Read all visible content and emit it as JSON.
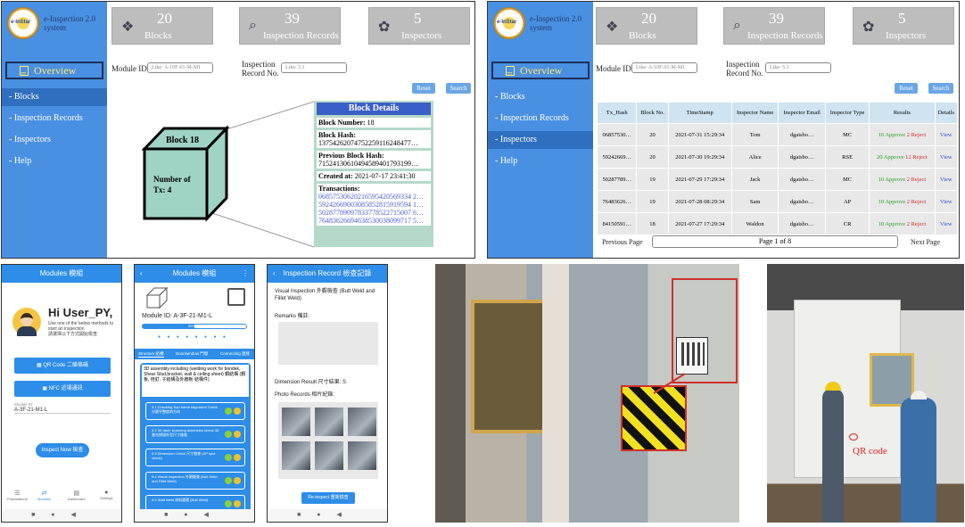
{
  "app": {
    "title_line1": "e-Inspection 2.0",
    "title_line2": "system",
    "logo_text": "e-InStar"
  },
  "sidebar": {
    "overview": "Overview",
    "items": [
      "- Blocks",
      "- Inspection Records",
      "- Inspectors",
      "- Help"
    ]
  },
  "stats": [
    {
      "value": "20",
      "label": "Blocks",
      "icon": "blocks-icon"
    },
    {
      "value": "39",
      "label": "Inspection Records",
      "icon": "clipboard-search-icon"
    },
    {
      "value": "5",
      "label": "Inspectors",
      "icon": "inspector-gear-icon"
    }
  ],
  "filters": {
    "module_label": "Module ID",
    "module_placeholder": "Like: A-10F-01-M-M1",
    "record_label_1": "Inspection",
    "record_label_2": "Record No.",
    "record_placeholder": "Like: 5.1",
    "reset": "Reset",
    "search": "Search"
  },
  "block_diagram": {
    "title": "Block 18",
    "body_1": "Number of",
    "body_2": "Tx: 4"
  },
  "block_details": {
    "header": "Block Details",
    "number_label": "Block Number:",
    "number": "18",
    "hash_label": "Block Hash:",
    "hash": "13754262074752259116248477…",
    "prev_label": "Previous Block Hash:",
    "prev": "71524130610494589401793199…",
    "created_label": "Created at:",
    "created": "2021-07-17 23:41:30",
    "tx_label": "Transactions:",
    "tx": [
      "06857530620216595420569334 2…",
      "59242669003085852815919594 1…",
      "50287789097833778522715007 6…",
      "76483626694638530038099717 5…"
    ]
  },
  "records": {
    "headers": [
      "Tx_Hash",
      "Block No.",
      "TimeStamp",
      "Inspector Name",
      "Inspector Email",
      "Inspector Type",
      "Results",
      "Details"
    ],
    "rows": [
      {
        "hash": "06857530…",
        "block": "20",
        "time": "2021-07-31 15:29:34",
        "name": "Tom",
        "email": "dgaisbo…",
        "type": "MC",
        "approve": "10 Approve",
        "reject": "2 Reject",
        "view": "View"
      },
      {
        "hash": "59242669…",
        "block": "20",
        "time": "2021-07-30 19:29:34",
        "name": "Alice",
        "email": "dgaisbo…",
        "type": "RSE",
        "approve": "20 Approve",
        "reject": "12 Reject",
        "view": "View"
      },
      {
        "hash": "50287789…",
        "block": "19",
        "time": "2021-07-29 17:29:34",
        "name": "Jack",
        "email": "dgaisbo…",
        "type": "MC",
        "approve": "10 Approve",
        "reject": "2 Reject",
        "view": "View"
      },
      {
        "hash": "76483626…",
        "block": "19",
        "time": "2021-07-28 08:29:34",
        "name": "Sam",
        "email": "dgaisbo…",
        "type": "AP",
        "approve": "10 Approve",
        "reject": "2 Reject",
        "view": "View"
      },
      {
        "hash": "84150591…",
        "block": "18",
        "time": "2021-07-27 17:29:34",
        "name": "Waldon",
        "email": "dgaisbo…",
        "type": "CR",
        "approve": "10 Approve",
        "reject": "2 Reject",
        "view": "View"
      }
    ],
    "prev": "Previous Page",
    "page": "Page 1 of 8",
    "next": "Next Page"
  },
  "phone1": {
    "title": "Modules 模組",
    "greeting": "Hi User_PY,",
    "sub": "Use one of the below methods to start an inspection",
    "sub_zh": "請選擇以下方式開始檢查",
    "qr": "QR Code 二維條碼",
    "nfc": "NFC 近場通訊",
    "module_label": "Module ID",
    "module_value": "A-3F-21-M1-L",
    "inspect": "Inspect Now 檢查",
    "tabs": [
      "Preparations",
      "Modules",
      "Dashboard",
      "Settings"
    ]
  },
  "phone2": {
    "title": "Modules 模組",
    "module": "Module ID: A-3F-21-M1-L",
    "progress": "50%",
    "tabs": [
      "Structure 結構",
      "Door/window 門窗",
      "Connecting 連接"
    ],
    "heading": "3D assembly including (welding work for bondek, Shear Stud,bracket, wall & ceiling sheet) 鋼結構 (鋼板, 栓釘, 子結構及外牆板 結構件)",
    "items": [
      "5.1 Checking Sub frame Alignment Check 分層平整度的方向",
      "5.2 3D laser scanning dimension check 3D激光掃描外型尺寸檢查",
      "5.3 Dimension Check 尺寸檢查 (AP spot check)",
      "5.4 Visual Inspection 外觀檢查 (Butt Weld and Fillet Weld)",
      "5.5 Staff Weld 材料處理 (Butt Weld)"
    ]
  },
  "phone3": {
    "title": "Inspection Record 檢查記錄",
    "heading": "Visual Inspection 外觀檢查 (Butt Weld and Fillet Weld)",
    "remarks": "Remarks 備註:",
    "dimension": "Dimension Result 尺寸結果: S",
    "photos": "Photo Records 相片紀錄:",
    "reinspect": "Re-inspect 重新檢查"
  },
  "photos": {
    "qr_label": "QR code"
  }
}
